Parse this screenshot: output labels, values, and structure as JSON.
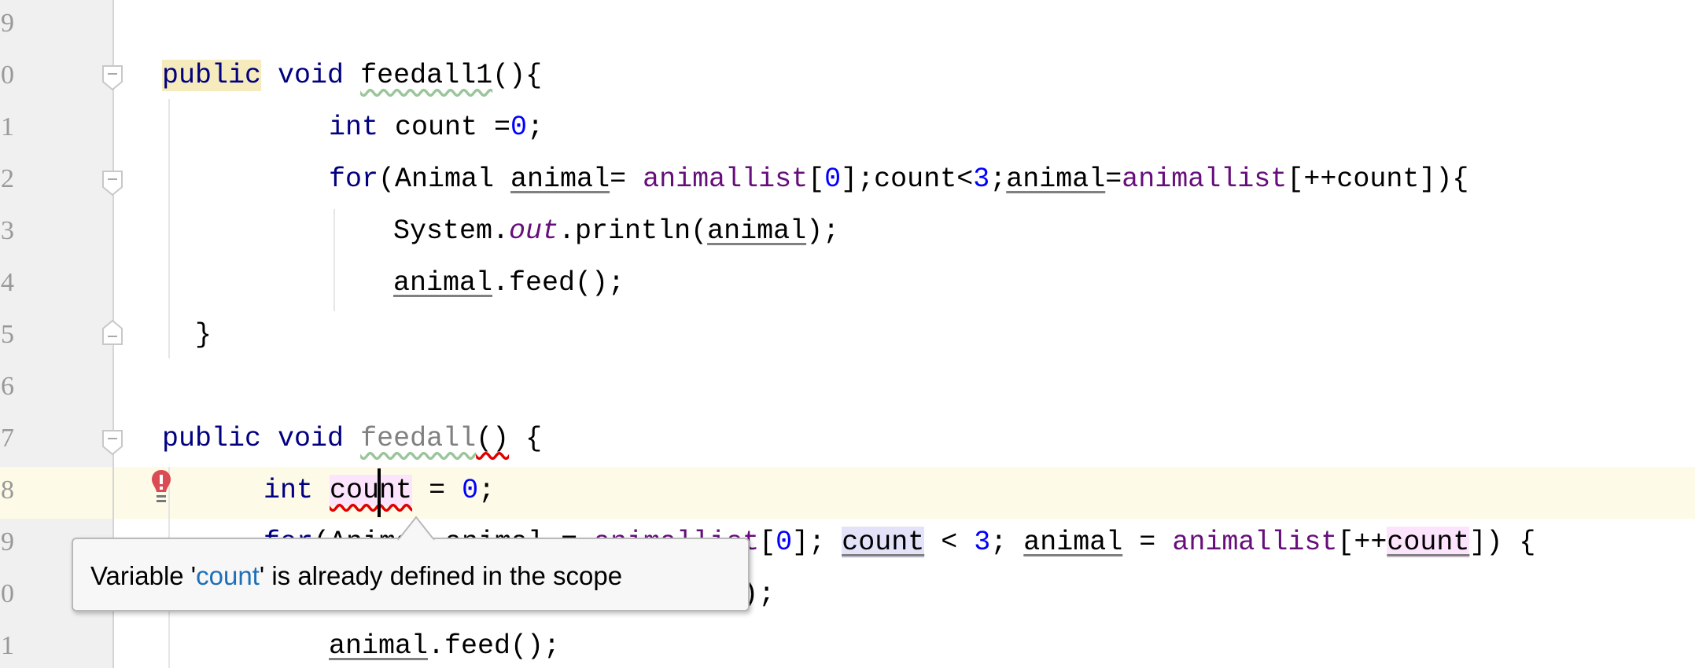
{
  "editor": {
    "line_numbers": [
      "9",
      "0",
      "1",
      "2",
      "3",
      "4",
      "5",
      "6",
      "7",
      "8",
      "9",
      "0",
      "1"
    ],
    "lines": [
      {
        "indent": 0,
        "tokens": []
      },
      {
        "indent": 206,
        "tokens": [
          {
            "t": "public",
            "c": "kw hl-y"
          },
          {
            "t": " "
          },
          {
            "t": "void",
            "c": "kw"
          },
          {
            "t": " "
          },
          {
            "t": "feedall1",
            "c": "warn"
          },
          {
            "t": "(){"
          }
        ]
      },
      {
        "indent": 418,
        "tokens": [
          {
            "t": "int",
            "c": "kw"
          },
          {
            "t": " count ="
          },
          {
            "t": "0",
            "c": "num"
          },
          {
            "t": ";"
          }
        ]
      },
      {
        "indent": 418,
        "tokens": [
          {
            "t": "for",
            "c": "kw"
          },
          {
            "t": "(Animal "
          },
          {
            "t": "animal",
            "c": "ul"
          },
          {
            "t": "= "
          },
          {
            "t": "animallist",
            "c": "fld"
          },
          {
            "t": "["
          },
          {
            "t": "0",
            "c": "num"
          },
          {
            "t": "];count<"
          },
          {
            "t": "3",
            "c": "num"
          },
          {
            "t": ";"
          },
          {
            "t": "animal",
            "c": "ul"
          },
          {
            "t": "="
          },
          {
            "t": "animallist",
            "c": "fld"
          },
          {
            "t": "[++count]){"
          }
        ]
      },
      {
        "indent": 500,
        "tokens": [
          {
            "t": "System."
          },
          {
            "t": "out",
            "c": "st"
          },
          {
            "t": ".println("
          },
          {
            "t": "animal",
            "c": "ul"
          },
          {
            "t": ");"
          }
        ]
      },
      {
        "indent": 500,
        "tokens": [
          {
            "t": "animal",
            "c": "ul"
          },
          {
            "t": ".feed();"
          }
        ]
      },
      {
        "indent": 248,
        "tokens": [
          {
            "t": "}"
          }
        ]
      },
      {
        "indent": 0,
        "tokens": []
      },
      {
        "indent": 206,
        "tokens": [
          {
            "t": "public",
            "c": "kw"
          },
          {
            "t": " "
          },
          {
            "t": "void",
            "c": "kw"
          },
          {
            "t": " "
          },
          {
            "t": "feedall",
            "c": "unused warn"
          },
          {
            "t": "()",
            "c": "err"
          },
          {
            "t": " {"
          }
        ]
      },
      {
        "indent": 335,
        "tokens": [
          {
            "t": "int",
            "c": "kw"
          },
          {
            "t": " "
          },
          {
            "t": "count",
            "c": "hl-p err"
          },
          {
            "t": " = "
          },
          {
            "t": "0",
            "c": "num"
          },
          {
            "t": ";"
          }
        ]
      },
      {
        "indent": 335,
        "tokens": [
          {
            "t": "for",
            "c": "kw"
          },
          {
            "t": "(Animal "
          },
          {
            "t": "animal",
            "c": "ul"
          },
          {
            "t": " = "
          },
          {
            "t": "animallist",
            "c": "fld"
          },
          {
            "t": "["
          },
          {
            "t": "0",
            "c": "num"
          },
          {
            "t": "]; "
          },
          {
            "t": "count",
            "c": "ul hl-b"
          },
          {
            "t": " < "
          },
          {
            "t": "3",
            "c": "num"
          },
          {
            "t": "; "
          },
          {
            "t": "animal",
            "c": "ul"
          },
          {
            "t": " = "
          },
          {
            "t": "animallist",
            "c": "fld"
          },
          {
            "t": "[++"
          },
          {
            "t": "count",
            "c": "ul hl-p"
          },
          {
            "t": "]) {"
          }
        ]
      },
      {
        "indent": 418,
        "tokens": [
          {
            "t": "System."
          },
          {
            "t": "out",
            "c": "st"
          },
          {
            "t": ".println("
          },
          {
            "t": "animal",
            "c": "ul"
          },
          {
            "t": ");"
          }
        ]
      },
      {
        "indent": 418,
        "tokens": [
          {
            "t": "animal",
            "c": "ul"
          },
          {
            "t": ".feed();"
          }
        ]
      }
    ]
  },
  "tooltip": {
    "prefix": "Variable '",
    "ref": "count",
    "suffix": "' is already defined in the scope"
  },
  "colors": {
    "keyword": "#000080",
    "number": "#0000ff",
    "field": "#660e7a",
    "error": "#e00000",
    "current_line": "#fdfbe7"
  },
  "icons": {
    "gutter_error": "error-bulb-icon",
    "fold": "fold-marker-icon"
  }
}
